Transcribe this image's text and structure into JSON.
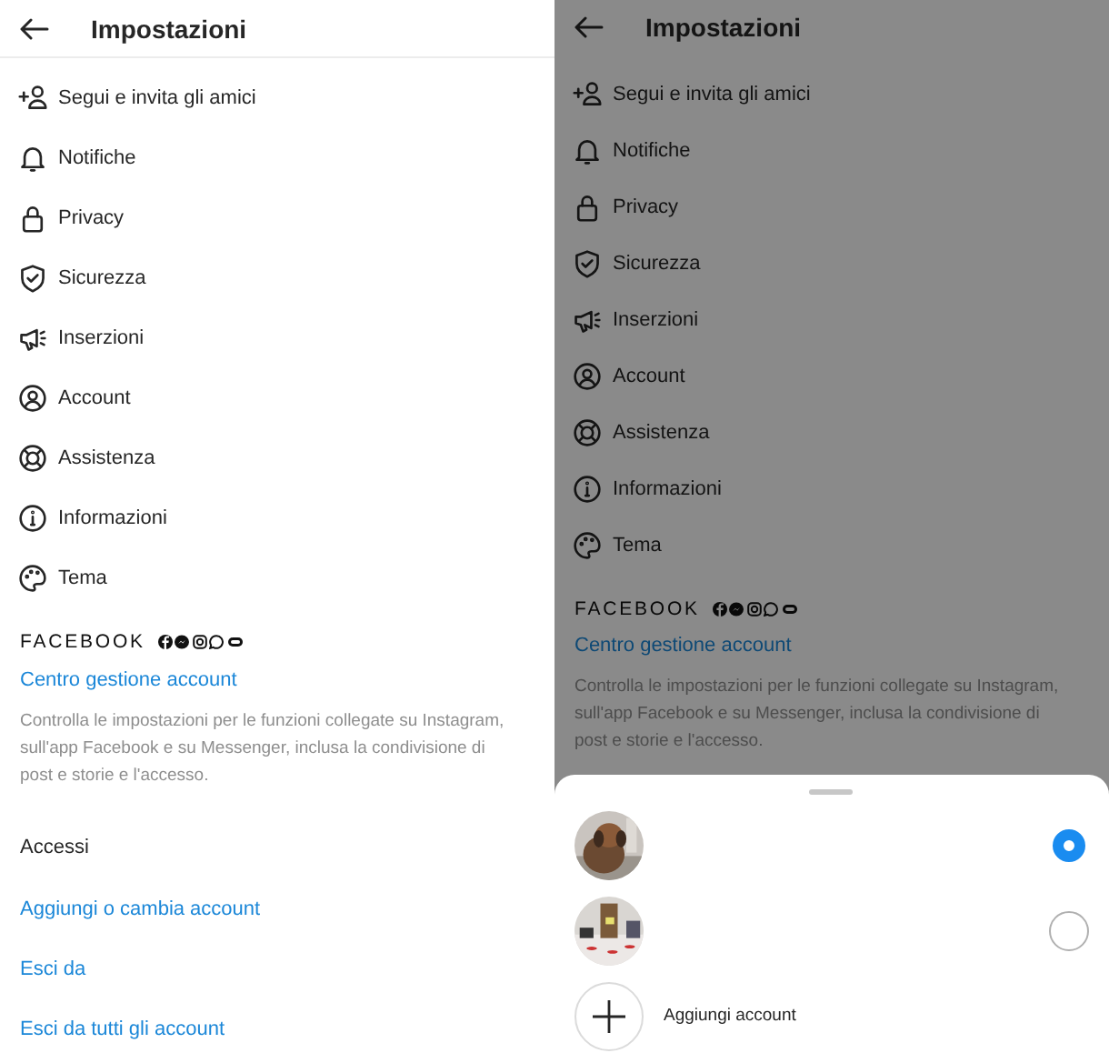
{
  "left_screen": {
    "title": "Impostazioni",
    "dimmed": false,
    "menu": [
      {
        "kind": "add-person",
        "label": "Segui e invita gli amici"
      },
      {
        "kind": "bell",
        "label": "Notifiche"
      },
      {
        "kind": "lock",
        "label": "Privacy"
      },
      {
        "kind": "shield",
        "label": "Sicurezza"
      },
      {
        "kind": "megaphone",
        "label": "Inserzioni"
      },
      {
        "kind": "person-circle",
        "label": "Account"
      },
      {
        "kind": "lifebuoy",
        "label": "Assistenza"
      },
      {
        "kind": "info",
        "label": "Informazioni"
      },
      {
        "kind": "palette",
        "label": "Tema"
      }
    ],
    "brand": "FACEBOOK",
    "brand_link": "Centro gestione account",
    "brand_note": "Controlla le impostazioni per le funzioni collegate su Instagram, sull'app Facebook e su Messenger, inclusa la condivisione di post e storie e l'accesso.",
    "section_title": "Accessi",
    "links": [
      "Aggiungi o cambia account",
      "Esci da",
      "Esci da tutti gli account"
    ]
  },
  "right_screen": {
    "title": "Impostazioni",
    "dimmed": true,
    "menu": [
      {
        "kind": "add-person",
        "label": "Segui e invita gli amici"
      },
      {
        "kind": "bell",
        "label": "Notifiche"
      },
      {
        "kind": "lock",
        "label": "Privacy"
      },
      {
        "kind": "shield",
        "label": "Sicurezza"
      },
      {
        "kind": "megaphone",
        "label": "Inserzioni"
      },
      {
        "kind": "person-circle",
        "label": "Account"
      },
      {
        "kind": "lifebuoy",
        "label": "Assistenza"
      },
      {
        "kind": "info",
        "label": "Informazioni"
      },
      {
        "kind": "palette",
        "label": "Tema"
      }
    ],
    "brand": "FACEBOOK",
    "brand_link": "Centro gestione account",
    "brand_note": "Controlla le impostazioni per le funzioni collegate su Instagram, sull'app Facebook e su Messenger, inclusa la condivisione di post e storie e l'accesso.",
    "account_sheet": {
      "accounts": [
        {
          "kind": "picture",
          "selected": true
        },
        {
          "kind": "picture",
          "selected": false
        }
      ],
      "add_label": "Aggiungi account"
    }
  }
}
